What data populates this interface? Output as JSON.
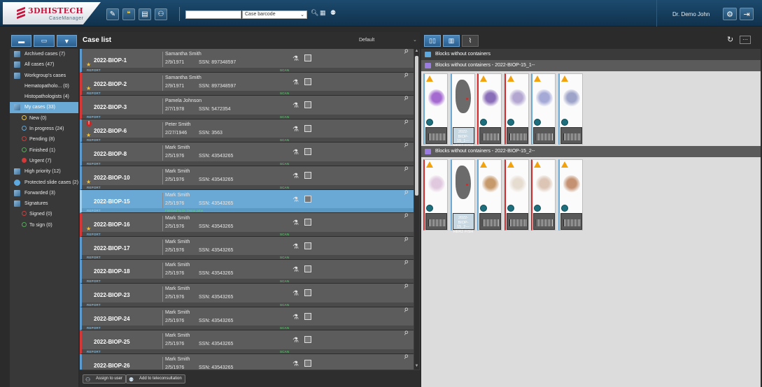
{
  "app": {
    "brand": "3DHISTECH",
    "product": "CaseManager",
    "user": "Dr. Demo John"
  },
  "search": {
    "value": "",
    "mode_selected": "Case barcode"
  },
  "sidebar": {
    "items": [
      {
        "label": "Archived cases (7)",
        "icon": "archive-icon",
        "level": 0
      },
      {
        "label": "All cases (47)",
        "icon": "document-icon",
        "level": 0
      },
      {
        "label": "Workgroup's cases",
        "icon": "workgroup-icon",
        "level": 0
      },
      {
        "label": "Hematopatholo... (0)",
        "icon": "",
        "level": 1
      },
      {
        "label": "Histopathologists (4)",
        "icon": "",
        "level": 1
      },
      {
        "label": "My cases (33)",
        "icon": "document-icon",
        "level": 0,
        "selected": true
      },
      {
        "label": "New (0)",
        "icon": "status-circle-icon",
        "level": 2,
        "color": "#f1c232"
      },
      {
        "label": "In progress (24)",
        "icon": "status-circle-icon",
        "level": 2,
        "color": "#5ea8e0"
      },
      {
        "label": "Pending (8)",
        "icon": "status-circle-icon",
        "level": 2,
        "color": "#d63838"
      },
      {
        "label": "Finished (1)",
        "icon": "status-circle-icon",
        "level": 2,
        "color": "#4caf50"
      },
      {
        "label": "Urgent (7)",
        "icon": "urgent-icon",
        "level": 2,
        "color": "#d63838"
      },
      {
        "label": "High priority (12)",
        "icon": "document-icon",
        "level": 0
      },
      {
        "label": "Protected slide cases (2)",
        "icon": "shield-icon",
        "level": 0
      },
      {
        "label": "Forwarded (3)",
        "icon": "document-icon",
        "level": 0
      },
      {
        "label": "Signatures",
        "icon": "document-icon",
        "level": 0
      },
      {
        "label": "Signed (0)",
        "icon": "status-circle-icon",
        "level": 2,
        "color": "#d63838"
      },
      {
        "label": "To sign (0)",
        "icon": "status-circle-icon",
        "level": 2,
        "color": "#4caf50"
      }
    ]
  },
  "case_list": {
    "title": "Case list",
    "sort": "Default",
    "report_label": "REPORT",
    "scan_label": "SCAN",
    "rows": [
      {
        "id": "2022-BIOP-1",
        "name": "Samantha Smith",
        "dob": "2/9/1971",
        "ssn": "SSN: 897348597",
        "star": true,
        "urgent": false,
        "edge": "blue",
        "status": "SCAN"
      },
      {
        "id": "2022-BIOP-2",
        "name": "Samantha Smith",
        "dob": "2/9/1971",
        "ssn": "SSN: 897348597",
        "star": true,
        "urgent": false,
        "edge": "red",
        "status": "SCAN"
      },
      {
        "id": "2022-BIOP-3",
        "name": "Pamela Johnson",
        "dob": "2/7/1978",
        "ssn": "SSN: 5472354",
        "star": false,
        "urgent": false,
        "edge": "red",
        "status": "SCAN"
      },
      {
        "id": "2022-BIOP-6",
        "name": "Peter Smith",
        "dob": "2/27/1946",
        "ssn": "SSN: 3563",
        "star": true,
        "urgent": true,
        "edge": "blue",
        "status": "SCAN"
      },
      {
        "id": "2022-BIOP-8",
        "name": "Mark Smith",
        "dob": "2/5/1976",
        "ssn": "SSN: 43543265",
        "star": false,
        "urgent": false,
        "edge": "blue",
        "status": "SCAN"
      },
      {
        "id": "2022-BIOP-10",
        "name": "Mark Smith",
        "dob": "2/5/1976",
        "ssn": "SSN: 43543265",
        "star": true,
        "urgent": false,
        "edge": "blue",
        "status": "SCAN"
      },
      {
        "id": "2022-BIOP-15",
        "name": "Mark Smith",
        "dob": "2/5/1976",
        "ssn": "SSN: 43543265",
        "star": false,
        "urgent": false,
        "edge": "green",
        "status": "Finished by Dr. Demo John",
        "selected": true
      },
      {
        "id": "2022-BIOP-16",
        "name": "Mark Smith",
        "dob": "2/5/1976",
        "ssn": "SSN: 43543265",
        "star": true,
        "urgent": false,
        "edge": "red",
        "status": "SCAN"
      },
      {
        "id": "2022-BIOP-17",
        "name": "Mark Smith",
        "dob": "2/5/1976",
        "ssn": "SSN: 43543265",
        "star": false,
        "urgent": false,
        "edge": "blue",
        "status": "SCAN"
      },
      {
        "id": "2022-BIOP-18",
        "name": "Mark Smith",
        "dob": "2/5/1976",
        "ssn": "SSN: 43543265",
        "star": false,
        "urgent": false,
        "edge": "blue",
        "status": "SCAN"
      },
      {
        "id": "2022-BIOP-23",
        "name": "Mark Smith",
        "dob": "2/5/1976",
        "ssn": "SSN: 43543265",
        "star": false,
        "urgent": false,
        "edge": "blue",
        "status": "SCAN"
      },
      {
        "id": "2022-BIOP-24",
        "name": "Mark Smith",
        "dob": "2/5/1976",
        "ssn": "SSN: 43543265",
        "star": false,
        "urgent": false,
        "edge": "blue",
        "status": "SCAN"
      },
      {
        "id": "2022-BIOP-25",
        "name": "Mark Smith",
        "dob": "2/5/1976",
        "ssn": "SSN: 43543265",
        "star": false,
        "urgent": false,
        "edge": "red",
        "status": "SCAN"
      },
      {
        "id": "2022-BIOP-26",
        "name": "Mark Smith",
        "dob": "2/5/1976",
        "ssn": "SSN: 43543265",
        "star": false,
        "urgent": false,
        "edge": "blue",
        "status": "SCAN"
      }
    ],
    "actions": {
      "assign": "Assign to user",
      "teleconsult": "Add to teleconsultation"
    }
  },
  "right_panel": {
    "blocks_header": "Blocks without containers",
    "groups": [
      {
        "title": "Blocks without containers - 2022-BIOP-15_1--",
        "label_text": "2022-BIOP-15_1---HER2 FISH"
      },
      {
        "title": "Blocks without containers - 2022-BIOP-15_2--",
        "label_text": "2022-BIOP-15_2---HER2 FISH"
      }
    ]
  },
  "colors": {
    "accent": "#6aa9d5",
    "urgent": "#d63838",
    "star": "#f1c232",
    "scan": "#67d07a",
    "brand": "#c8143c"
  }
}
